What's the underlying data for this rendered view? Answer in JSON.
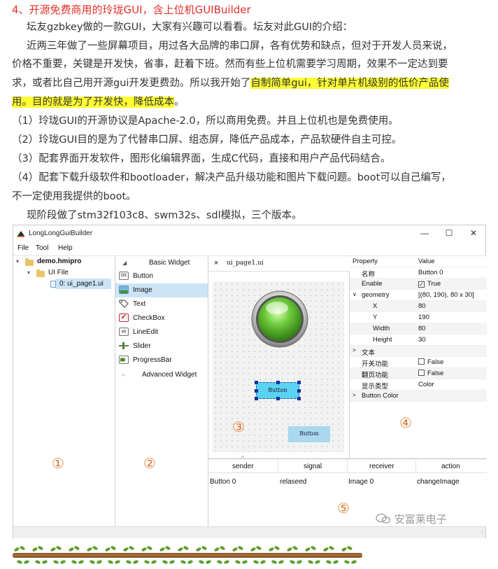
{
  "article": {
    "heading": "4、开源免费商用的玲珑GUI，含上位机GUIBuilder",
    "p1": "坛友gzbkey做的一款GUI，大家有兴趣可以看看。坛友对此GUI的介绍：",
    "p2_l1": "近两三年做了一些屏幕项目，用过各大品牌的串口屏，各有优势和缺点，但对于开发人员来说，",
    "p2_l2": "价格不重要，关键是开发快，省事，赶着下班。然而有些上位机需要学习周期，效果不一定达到要",
    "p2_l3a": "求，或者比自己用开源gui开发更费劲。所以我开始了",
    "p2_l3b": "自制简单gui，针对单片机级别的低价产品使",
    "p2_l4a": "用。目的就是为了开发快，降低成本",
    "p2_l4b": "。",
    "p3": "（1）玲珑GUI的开源协议是Apache-2.0，所以商用免费。并且上位机也是免费使用。",
    "p4": "（2）玲珑GUI目的是为了代替串口屏、组态屏，降低产品成本，产品软硬件自主可控。",
    "p5": "（3）配套界面开发软件，图形化编辑界面，生成C代码，直接和用户产品代码结合。",
    "p6_l1": "（4）配套下载升级软件和bootloader，解决产品升级功能和图片下载问题。boot可以自己编写，",
    "p6_l2": "不一定使用我提供的boot。",
    "p7": "现阶段做了stm32f103c8、swm32s、sdl模拟，三个版本。"
  },
  "app": {
    "title": "LongLongGuiBuilder",
    "controls": {
      "minimize": "—",
      "maximize": "☐",
      "close": "✕"
    },
    "menu": [
      "File",
      "Tool",
      "Help"
    ],
    "project_tree": {
      "root": "demo.hmipro",
      "folder": "UI File",
      "page": "0: ui_page1.ui"
    },
    "widgets": {
      "header": "Basic Widget",
      "items": [
        {
          "label": "Button",
          "icon": "button-icon",
          "badge": "OK"
        },
        {
          "label": "Image",
          "icon": "image-icon",
          "badge": ""
        },
        {
          "label": "Text",
          "icon": "text-tag-icon",
          "badge": ""
        },
        {
          "label": "CheckBox",
          "icon": "checkbox-icon",
          "badge": "✔"
        },
        {
          "label": "LineEdit",
          "icon": "lineedit-icon",
          "badge": "ab|"
        },
        {
          "label": "Slider",
          "icon": "slider-icon",
          "badge": ""
        },
        {
          "label": "ProgressBar",
          "icon": "progressbar-icon",
          "badge": ""
        }
      ],
      "advanced": "Advanced Widget"
    },
    "editor": {
      "tab_close": "×",
      "tab_name": "ui_page1.ui",
      "button1": "Button",
      "button2": "Button"
    },
    "properties": {
      "header_key": "Property",
      "header_val": "Value",
      "rows": [
        {
          "key": "名称",
          "value": "Button 0"
        },
        {
          "key": "Enable",
          "value": "True",
          "checked": true
        },
        {
          "key": "geometry",
          "value": "[(80, 190), 80 x 30]"
        },
        {
          "key": "X",
          "value": "80"
        },
        {
          "key": "Y",
          "value": "190"
        },
        {
          "key": "Width",
          "value": "80"
        },
        {
          "key": "Height",
          "value": "30"
        },
        {
          "key": "文本",
          "value": ""
        },
        {
          "key": "开关功能",
          "value": "False",
          "checked": false
        },
        {
          "key": "翻页功能",
          "value": "False",
          "checked": false
        },
        {
          "key": "显示类型",
          "value": "Color"
        },
        {
          "key": "Button Color",
          "value": ""
        }
      ]
    },
    "signals": {
      "headers": [
        "sender",
        "signal",
        "receiver",
        "action"
      ],
      "row": [
        "Button 0",
        "relaseed",
        "Image 0",
        "changeImage"
      ]
    },
    "region_marks": [
      "①",
      "②",
      "③",
      "④",
      "⑤"
    ]
  },
  "watermark": "安富莱电子",
  "colors": {
    "heading": "#e0302a",
    "highlight": "#ffff33",
    "selection": "#cce4f7",
    "button_fill": "#5bd3f0",
    "led_green": "#5fbf2e"
  }
}
